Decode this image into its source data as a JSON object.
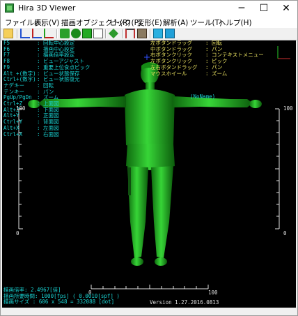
{
  "window": {
    "title": "Hira 3D Viewer",
    "minimize": "─",
    "maximize": "☐",
    "close": "✕"
  },
  "menu": [
    "ファイル(F)",
    "表示(V)",
    "描画オブジェクト(R)",
    "ピック(P)",
    "変形(E)",
    "解析(A)",
    "ツール(T)",
    "ヘルプ(H)"
  ],
  "shortcuts_left": [
    [
      "F5",
      ": 回転中心設定"
    ],
    [
      "F6",
      ": 描画中心設定"
    ],
    [
      "F7",
      ": 描画倍率設定"
    ],
    [
      "F8",
      ": ビューアジャスト"
    ],
    [
      "F9",
      ": 重要上位食点ピック"
    ],
    [
      "Alt +(数字)",
      ": ビュー状態保存"
    ],
    [
      "Ctrl+(数字)",
      ": ビュー状態復元"
    ],
    [
      "ナデキー",
      ": 回転"
    ],
    [
      "テンキー",
      ": パン"
    ],
    [
      "PgUp/PgDn",
      ": ズーム"
    ],
    [
      "Ctrl+Z",
      ": 上面図"
    ],
    [
      "Alt+Z",
      ": 下面図"
    ],
    [
      "Alt+Y",
      ": 正面図"
    ],
    [
      "Ctrl+Y",
      ": 背面図"
    ],
    [
      "Alt+X",
      ": 左面図"
    ],
    [
      "Ctrl+X",
      ": 右面図"
    ]
  ],
  "mouse_help": [
    [
      "左ボタンドラッグ",
      ": 回転"
    ],
    [
      "中ボタンドラッグ",
      ": パン"
    ],
    [
      "右ボタンクリック",
      ": コンテキストメニュー"
    ],
    [
      "左ボタンクリック",
      ": ピック"
    ],
    [
      "左右ボタンドラッグ",
      ": パン"
    ],
    [
      "マウスホイール",
      ": ズーム"
    ]
  ],
  "model_label": "(NoName)",
  "scale": {
    "left": {
      "top": "100",
      "bottom": "0"
    },
    "right": {
      "top": "100",
      "bottom": "0"
    },
    "bottom": {
      "left": "0",
      "right": "100"
    }
  },
  "status": {
    "zoom": "描画倍率: 2.4967[倍]",
    "time": "描画所要時間: 1000[fps] ( 0.0010[spf] )",
    "size": "描画サイズ : 606 x 548 = 332088 [dot]",
    "version": "Version 1.27.2016.0813"
  },
  "colors": {
    "help_text": "#19d4d4",
    "mouse_text": "#e8e060",
    "model": "#1fbf1f",
    "background": "#000000"
  }
}
